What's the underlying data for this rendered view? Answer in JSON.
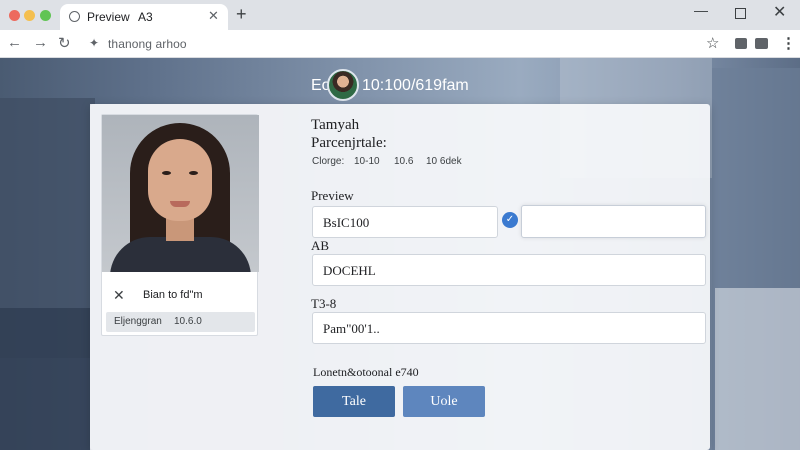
{
  "browser": {
    "tab_title": "Preview",
    "tab_subtitle": "A3",
    "url": "thanong arhoo"
  },
  "header": {
    "prefix": "Eola",
    "time": "10:100/619fam"
  },
  "profile": {
    "name": "Bian to fd\"m",
    "detail_label": "Eljenggran",
    "detail_value": "10.6.0"
  },
  "form": {
    "title": "Tamyah",
    "subtitle": "Parcenjrtale:",
    "meta": [
      "Clorge:",
      "10-10",
      "10.6",
      "10 6dek"
    ],
    "preview_label": "Preview",
    "preview_value": "BsIC100",
    "preview_secondary_value": "",
    "ab_label": "AB",
    "ab_value": "DOCEHL",
    "t38_label": "T3-8",
    "t38_value": "Pam\"00'1..",
    "note": "Lonetn&otoonal e740",
    "btn_primary": "Tale",
    "btn_secondary": "Uole"
  },
  "icons": {
    "check": "check-icon",
    "close": "close-icon"
  },
  "colors": {
    "primary_button": "#3f6aa0",
    "secondary_button": "#5e86be",
    "check": "#3b7ad0"
  }
}
